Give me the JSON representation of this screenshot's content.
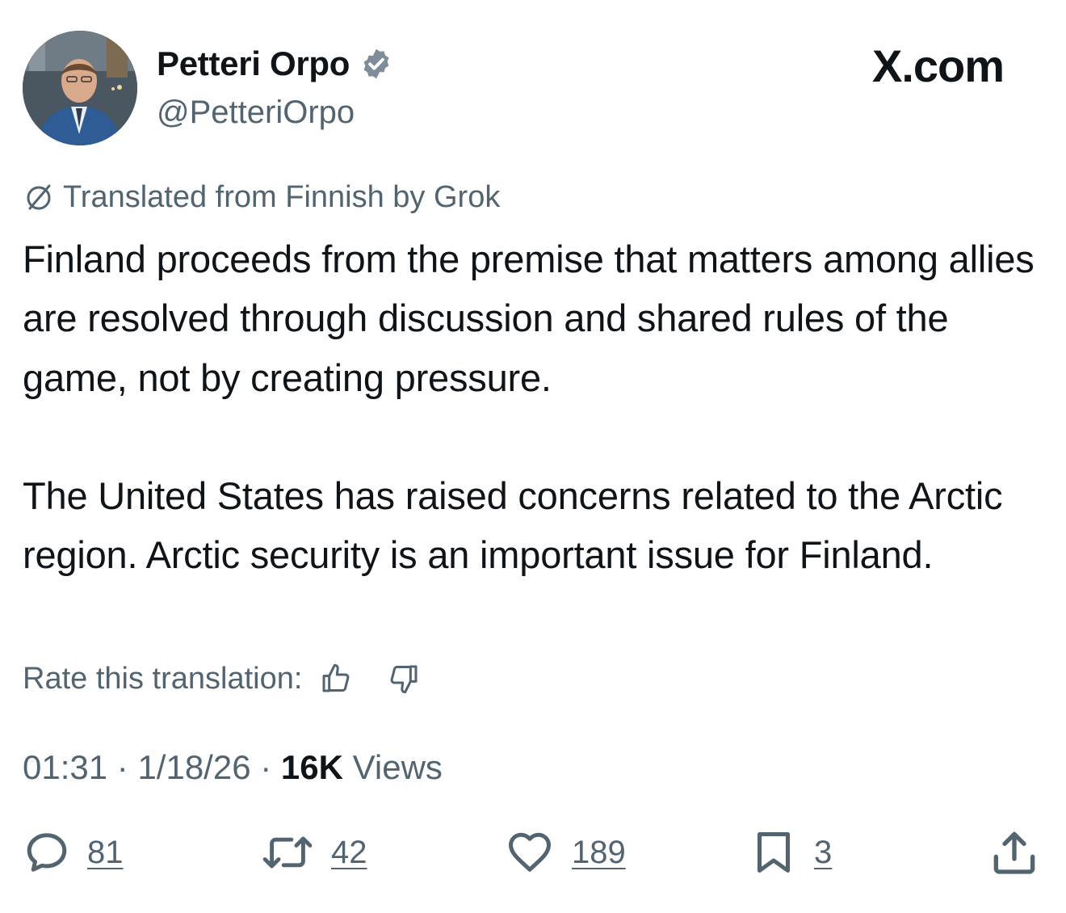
{
  "profile": {
    "display_name": "Petteri Orpo",
    "handle": "@PetteriOrpo",
    "verified_icon": "verified-badge-icon",
    "badge_color": "#7f8c99"
  },
  "brand": {
    "label": "X.com"
  },
  "translation": {
    "icon": "grok-icon",
    "notice": "Translated from Finnish by Grok",
    "rate_label": "Rate this translation:",
    "thumbs_up_icon": "thumbs-up-icon",
    "thumbs_down_icon": "thumbs-down-icon"
  },
  "post": {
    "paragraph_1": "Finland proceeds from the premise that matters among allies are resolved through discussion and shared rules of the game, not by creating pressure.",
    "paragraph_2": "The United States has raised concerns related to the Arctic region. Arctic security is an important issue for Finland."
  },
  "meta": {
    "time": "01:31",
    "separator": " · ",
    "date": "1/18/26",
    "views_count": "16K",
    "views_label": "Views"
  },
  "actions": {
    "replies": "81",
    "reposts": "42",
    "likes": "189",
    "bookmarks": "3",
    "icons": [
      "reply-icon",
      "repost-icon",
      "like-icon",
      "bookmark-icon",
      "share-icon"
    ]
  },
  "colors": {
    "text_primary": "#0f1419",
    "text_secondary": "#536471",
    "background": "#ffffff"
  }
}
